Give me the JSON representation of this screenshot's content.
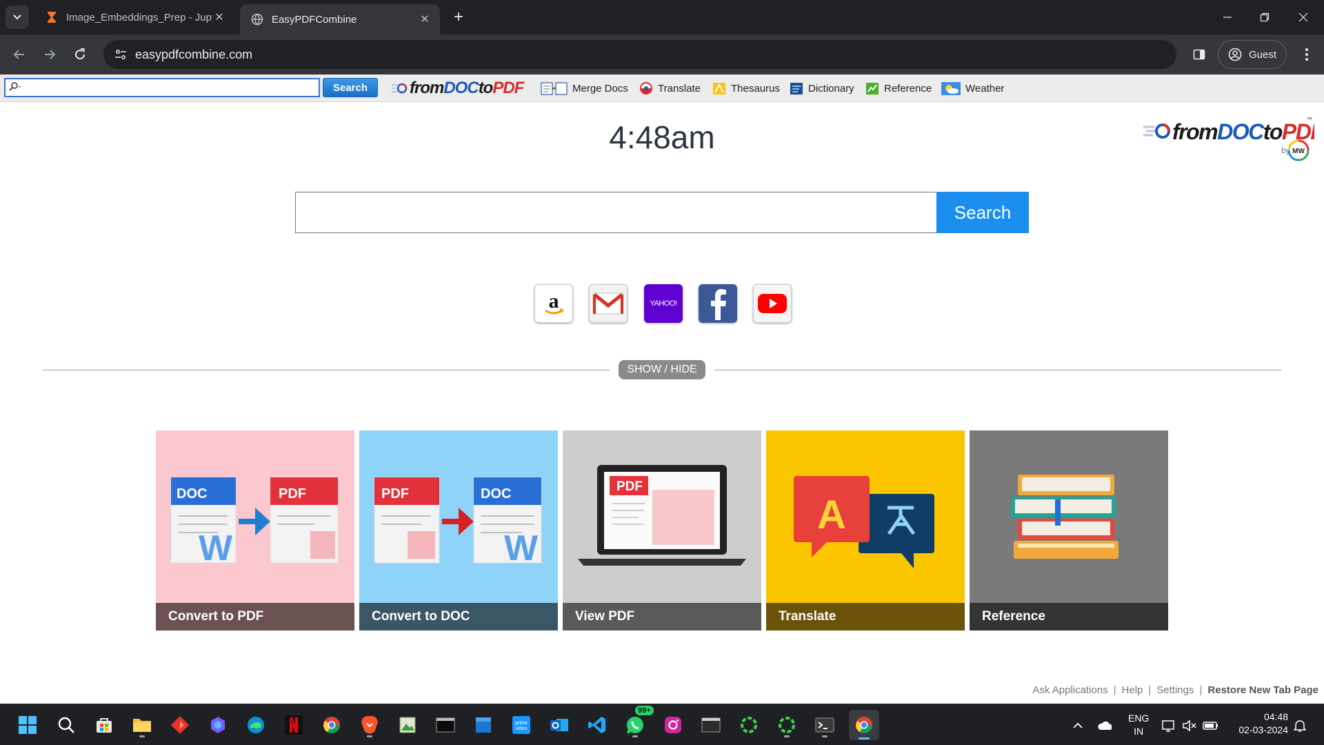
{
  "browser": {
    "tabs": [
      {
        "title": "Image_Embeddings_Prep - Jupyter",
        "icon": "hourglass-icon",
        "active": false
      },
      {
        "title": "EasyPDFCombine",
        "icon": "globe-icon",
        "active": true
      }
    ],
    "url": "easypdfcombine.com",
    "profile_label": "Guest"
  },
  "extension_bar": {
    "search_button": "Search",
    "logo_text": "fromDOCtoPDF",
    "links": [
      {
        "label": "Merge Docs",
        "icon": "merge-docs-icon"
      },
      {
        "label": "Translate",
        "icon": "translate-icon"
      },
      {
        "label": "Thesaurus",
        "icon": "thesaurus-icon"
      },
      {
        "label": "Dictionary",
        "icon": "dictionary-icon"
      },
      {
        "label": "Reference",
        "icon": "reference-icon"
      },
      {
        "label": "Weather",
        "icon": "weather-icon"
      }
    ]
  },
  "page": {
    "clock": "4:48am",
    "brand": {
      "name": "fromDOCtoPDF",
      "tm": "™",
      "by": "by",
      "badge": "MW"
    },
    "search_button": "Search",
    "quick_links": [
      {
        "name": "amazon",
        "icon": "amazon-icon"
      },
      {
        "name": "gmail",
        "icon": "gmail-icon"
      },
      {
        "name": "yahoo",
        "icon": "yahoo-icon",
        "text": "YAHOO!"
      },
      {
        "name": "facebook",
        "icon": "facebook-icon"
      },
      {
        "name": "youtube",
        "icon": "youtube-icon"
      }
    ],
    "show_hide": "SHOW / HIDE",
    "tiles": [
      {
        "label": "Convert to PDF",
        "bg": "#fbc8cf",
        "caption_bg": "#6b5152"
      },
      {
        "label": "Convert to DOC",
        "bg": "#8fd3f8",
        "caption_bg": "#3b5665"
      },
      {
        "label": "View PDF",
        "bg": "#cdcdcd",
        "caption_bg": "#5a5a5a"
      },
      {
        "label": "Translate",
        "bg": "#fbc500",
        "caption_bg": "#6a5208"
      },
      {
        "label": "Reference",
        "bg": "#7a7a7a",
        "caption_bg": "#343434"
      }
    ],
    "tile_art_text": {
      "doc": "DOC",
      "pdf": "PDF",
      "w": "W",
      "a": "A"
    },
    "footer": {
      "links": [
        "Ask Applications",
        "Help",
        "Settings"
      ],
      "restore": "Restore New Tab Page"
    }
  },
  "taskbar": {
    "apps": [
      "start-icon",
      "search-icon",
      "store-icon",
      "file-explorer-icon",
      "app-red-icon",
      "copilot-icon",
      "edge-icon",
      "netflix-icon",
      "chrome-icon",
      "brave-icon",
      "photos-icon",
      "terminal-icon",
      "sticky-icon",
      "prime-video-icon",
      "outlook-icon",
      "vscode-icon",
      "whatsapp-icon",
      "instagram-icon",
      "cmd-icon",
      "ring-app-icon",
      "ring-app-2-icon",
      "powershell-icon",
      "chrome-active-icon"
    ],
    "whatsapp_badge": "99+",
    "lang_top": "ENG",
    "lang_bottom": "IN",
    "time": "04:48",
    "date": "02-03-2024"
  },
  "colors": {
    "accent": "#1a8ff0",
    "chrome_dark": "#202124",
    "chrome_toolbar": "#35363a"
  }
}
